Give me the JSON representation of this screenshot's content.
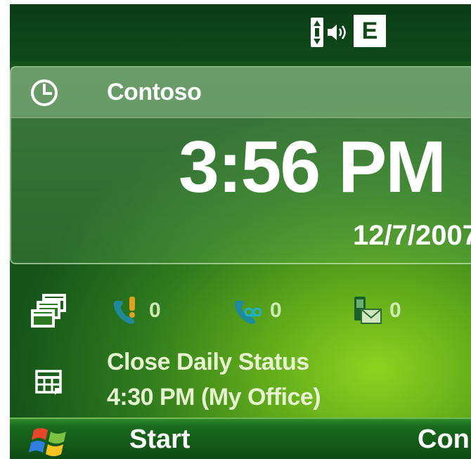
{
  "status_bar": {
    "network_badge": "E",
    "icons": [
      "signal-strength-icon",
      "speaker-icon",
      "edge-network-icon"
    ]
  },
  "clock": {
    "icon": "clock-icon",
    "owner": "Contoso",
    "time": "3:56 PM",
    "date": "12/7/2007"
  },
  "notifications": {
    "group_icon": "windows-icon",
    "missed_calls": {
      "icon": "missed-call-icon",
      "count": "0"
    },
    "voicemail": {
      "icon": "voicemail-icon",
      "count": "0"
    },
    "messages": {
      "icon": "message-icon",
      "count": "0"
    }
  },
  "appointment": {
    "icon": "calendar-icon",
    "title": "Close Daily Status",
    "detail": "4:30 PM (My Office)"
  },
  "softkeys": {
    "start_icon": "windows-logo-icon",
    "left": "Start",
    "right": "Con"
  },
  "colors": {
    "background_dark": "#14531a",
    "background_light": "#8ed21f",
    "text_primary": "#ffffff",
    "text_secondary": "#e6f5cf"
  }
}
